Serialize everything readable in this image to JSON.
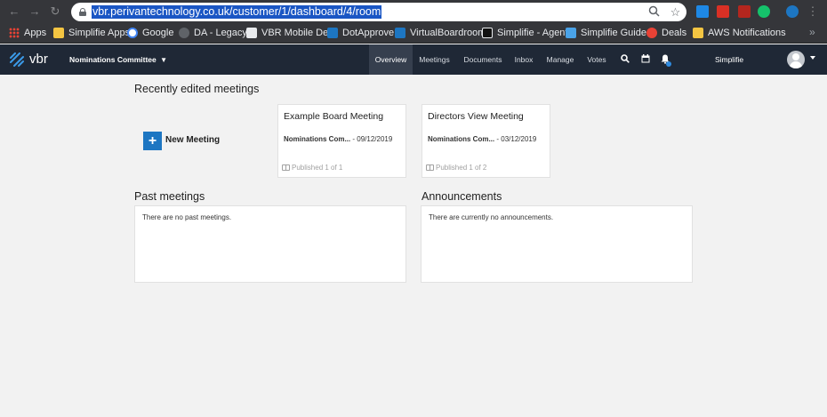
{
  "browser": {
    "url": "vbr.perivantechnology.co.uk/customer/1/dashboard/4/room",
    "bookmarks": [
      {
        "label": "Apps",
        "icon": "apps-grid-icon",
        "color": "#e94235"
      },
      {
        "label": "Simplifie Apps",
        "icon": "folder-icon",
        "color": "#f4c542"
      },
      {
        "label": "Google",
        "icon": "google-icon",
        "color": "#4285f4"
      },
      {
        "label": "DA - Legacy",
        "icon": "globe-icon",
        "color": "#80868b"
      },
      {
        "label": "VBR Mobile Dev",
        "icon": "page-icon",
        "color": "#e8eaed"
      },
      {
        "label": "DotApprove",
        "icon": "dotapprove-icon",
        "color": "#1d76c2"
      },
      {
        "label": "VirtualBoardroom",
        "icon": "vbr-icon",
        "color": "#1d76c2"
      },
      {
        "label": "Simplifie - Agent",
        "icon": "agent-icon",
        "color": "#1a1a1a"
      },
      {
        "label": "Simplifie Guides",
        "icon": "guides-icon",
        "color": "#4aa3e8"
      },
      {
        "label": "Deals",
        "icon": "deals-icon",
        "color": "#e94235"
      },
      {
        "label": "AWS Notifications",
        "icon": "folder-icon",
        "color": "#f4c542"
      }
    ],
    "more": "»"
  },
  "app": {
    "logo": "vbr",
    "committee": "Nominations Committee",
    "nav": [
      "Overview",
      "Meetings",
      "Documents",
      "Inbox",
      "Manage",
      "Votes"
    ],
    "user": "Simplifie",
    "accent": "#1d76c2"
  },
  "content": {
    "recent_title": "Recently edited meetings",
    "new_meeting": "New Meeting",
    "cards": [
      {
        "title": "Example Board Meeting",
        "committee": "Nominations Com...",
        "date": "- 09/12/2019",
        "published": "Published 1 of 1"
      },
      {
        "title": "Directors View Meeting",
        "committee": "Nominations Com...",
        "date": "- 03/12/2019",
        "published": "Published 1 of 2"
      }
    ],
    "past_title": "Past meetings",
    "past_empty": "There are no past meetings.",
    "ann_title": "Announcements",
    "ann_empty": "There are currently no announcements."
  }
}
